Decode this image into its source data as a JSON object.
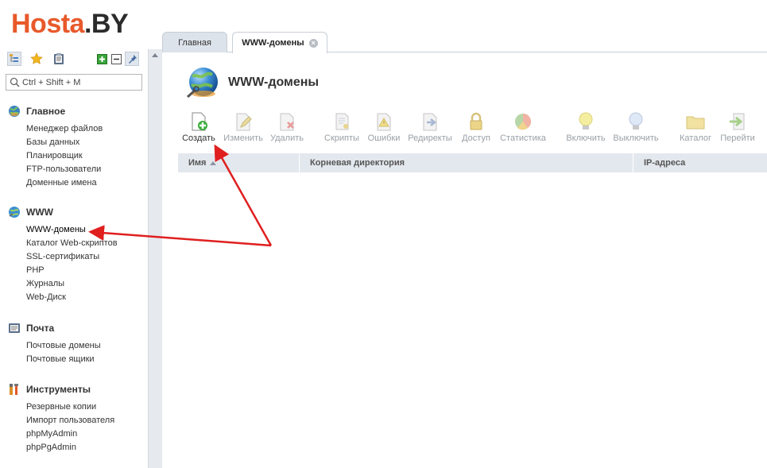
{
  "logo": {
    "brand": "Hosta",
    "tld": ".BY"
  },
  "sidebar": {
    "tool_icons": [
      "tree-view-icon",
      "favorites-star-icon",
      "clipboard-icon",
      "expand-all-icon",
      "collapse-all-icon",
      "pin-icon"
    ],
    "search": {
      "placeholder": "Ctrl + Shift + M",
      "value": ""
    },
    "groups": [
      {
        "title": "Главное",
        "icon": "globe-icon",
        "items": [
          "Менеджер файлов",
          "Базы данных",
          "Планировщик",
          "FTP-пользователи",
          "Доменные имена"
        ]
      },
      {
        "title": "WWW",
        "icon": "www-globe-icon",
        "items": [
          "WWW-домены",
          "Каталог Web-скриптов",
          "SSL-сертификаты",
          "PHP",
          "Журналы",
          "Web-Диск"
        ]
      },
      {
        "title": "Почта",
        "icon": "mail-icon",
        "items": [
          "Почтовые домены",
          "Почтовые ящики"
        ]
      },
      {
        "title": "Инструменты",
        "icon": "tools-icon",
        "items": [
          "Резервные копии",
          "Импорт пользователя",
          "phpMyAdmin",
          "phpPgAdmin"
        ]
      }
    ]
  },
  "tabs": [
    {
      "label": "Главная",
      "active": false
    },
    {
      "label": "WWW-домены",
      "active": true,
      "closable": true
    }
  ],
  "page": {
    "title": "WWW-домены",
    "icon": "www-globe-large-icon"
  },
  "toolbar": [
    {
      "label": "Создать",
      "icon": "create-icon",
      "enabled": true
    },
    {
      "label": "Изменить",
      "icon": "edit-icon",
      "enabled": false
    },
    {
      "label": "Удалить",
      "icon": "delete-icon",
      "enabled": false
    },
    {
      "label": "Скрипты",
      "icon": "scripts-icon",
      "enabled": false
    },
    {
      "label": "Ошибки",
      "icon": "errors-icon",
      "enabled": false
    },
    {
      "label": "Редиректы",
      "icon": "redirects-icon",
      "enabled": false
    },
    {
      "label": "Доступ",
      "icon": "lock-icon",
      "enabled": false
    },
    {
      "label": "Статистика",
      "icon": "statistics-icon",
      "enabled": false
    },
    {
      "label": "Включить",
      "icon": "enable-bulb-icon",
      "enabled": false
    },
    {
      "label": "Выключить",
      "icon": "disable-bulb-icon",
      "enabled": false
    },
    {
      "label": "Каталог",
      "icon": "folder-icon",
      "enabled": false
    },
    {
      "label": "Перейти",
      "icon": "goto-icon",
      "enabled": false
    }
  ],
  "table": {
    "columns": [
      {
        "label": "Имя",
        "sorted": "asc"
      },
      {
        "label": "Корневая директория"
      },
      {
        "label": "IP-адреса"
      }
    ],
    "rows": []
  },
  "colors": {
    "logo_orange": "#e8592b",
    "annotation_arrow": "#e01f1f",
    "header_bg": "#e3e8ee"
  }
}
